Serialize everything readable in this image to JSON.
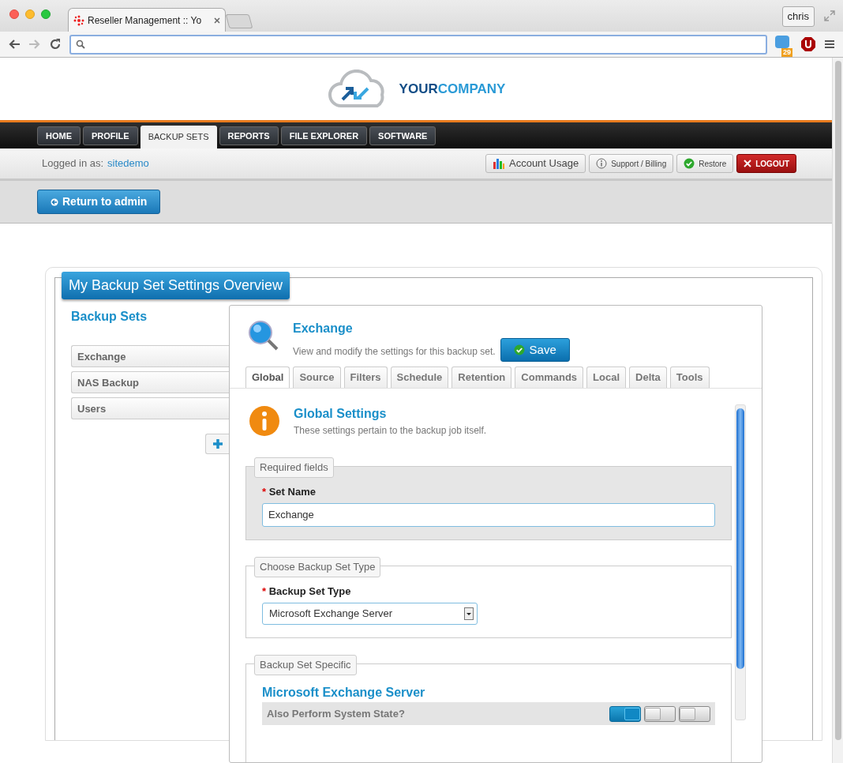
{
  "browser": {
    "tab_title": "Reseller Management :: Yo",
    "profile": "chris",
    "extension_badge": "29"
  },
  "header": {
    "logo_part_1": "YOUR",
    "logo_part_2": "COMPANY"
  },
  "nav": [
    {
      "label": "HOME",
      "selected": false
    },
    {
      "label": "PROFILE",
      "selected": false
    },
    {
      "label": "BACKUP SETS",
      "selected": true
    },
    {
      "label": "REPORTS",
      "selected": false
    },
    {
      "label": "FILE EXPLORER",
      "selected": false
    },
    {
      "label": "SOFTWARE",
      "selected": false
    }
  ],
  "user_bar": {
    "label": "Logged in as:",
    "user": "sitedemo",
    "buttons": [
      {
        "kind": "usage",
        "label": "Account Usage"
      },
      {
        "kind": "info",
        "label": "Support / Billing"
      },
      {
        "kind": "check",
        "label": "Restore"
      },
      {
        "kind": "logout",
        "label": "LOGOUT"
      }
    ]
  },
  "return_button": "Return to admin",
  "overview_title": "My Backup Set Settings Overview",
  "backup_sets": {
    "heading": "Backup Sets",
    "items": [
      "Exchange",
      "NAS Backup",
      "Users"
    ]
  },
  "panel": {
    "title": "Exchange",
    "description": "View and modify the settings for this backup set.",
    "save": "Save",
    "tabs": [
      {
        "label": "Global",
        "selected": true
      },
      {
        "label": "Source",
        "selected": false
      },
      {
        "label": "Filters",
        "selected": false
      },
      {
        "label": "Schedule",
        "selected": false
      },
      {
        "label": "Retention",
        "selected": false
      },
      {
        "label": "Commands",
        "selected": false
      },
      {
        "label": "Local",
        "selected": false
      },
      {
        "label": "Delta",
        "selected": false
      },
      {
        "label": "Tools",
        "selected": false
      }
    ],
    "section_title": "Global Settings",
    "section_description": "These settings pertain to the backup job itself.",
    "required": {
      "legend": "Required fields",
      "marker": "*",
      "label": "Set Name",
      "value": "Exchange"
    },
    "type": {
      "legend": "Choose Backup Set Type",
      "marker": "*",
      "label": "Backup Set Type",
      "value": "Microsoft Exchange Server"
    },
    "specific": {
      "legend": "Backup Set Specific",
      "title": "Microsoft Exchange Server",
      "question": "Also Perform System State?",
      "toggles": [
        {
          "on": true
        },
        {
          "on": false
        },
        {
          "on": false
        }
      ]
    }
  }
}
